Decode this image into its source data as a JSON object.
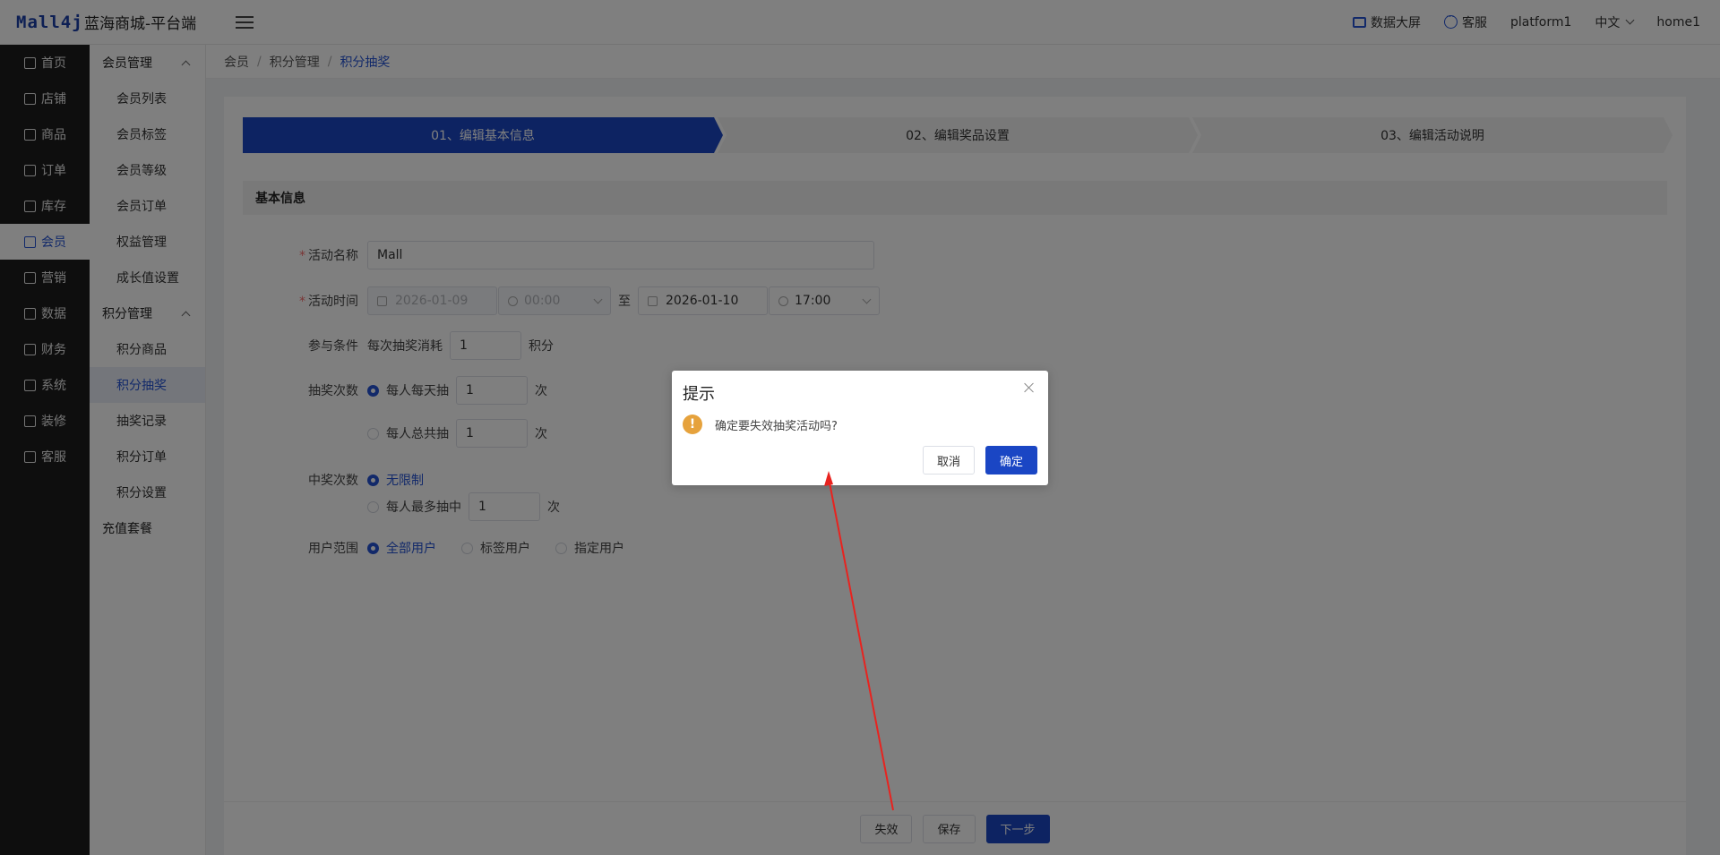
{
  "header": {
    "logo": "Mall4j",
    "app_title": "蓝海商城-平台端",
    "data_screen": "数据大屏",
    "customer_service": "客服",
    "user": "platform1",
    "language": "中文",
    "home": "home1"
  },
  "nav": {
    "items": [
      {
        "label": "首页"
      },
      {
        "label": "店铺"
      },
      {
        "label": "商品"
      },
      {
        "label": "订单"
      },
      {
        "label": "库存"
      },
      {
        "label": "会员"
      },
      {
        "label": "营销"
      },
      {
        "label": "数据"
      },
      {
        "label": "财务"
      },
      {
        "label": "系统"
      },
      {
        "label": "装修"
      },
      {
        "label": "客服"
      }
    ],
    "active_index": 5
  },
  "submenu": {
    "group1": "会员管理",
    "group1_items": [
      "会员列表",
      "会员标签",
      "会员等级",
      "会员订单",
      "权益管理",
      "成长值设置"
    ],
    "group2": "积分管理",
    "group2_items": [
      "积分商品",
      "积分抽奖",
      "抽奖记录",
      "积分订单",
      "积分设置"
    ],
    "extra": "充值套餐",
    "active_item": "积分抽奖"
  },
  "breadcrumb": {
    "items": [
      "会员",
      "积分管理",
      "积分抽奖"
    ]
  },
  "steps": [
    "01、编辑基本信息",
    "02、编辑奖品设置",
    "03、编辑活动说明"
  ],
  "form": {
    "section_title": "基本信息",
    "activity_name_label": "活动名称",
    "activity_name_value": "Mall",
    "activity_time_label": "活动时间",
    "start_date": "2026-01-09",
    "start_time": "00:00",
    "to": "至",
    "end_date": "2026-01-10",
    "end_time": "17:00",
    "condition_label": "参与条件",
    "condition_prefix": "每次抽奖消耗",
    "condition_value": "1",
    "condition_unit": "积分",
    "draw_times_label": "抽奖次数",
    "draw_daily_label": "每人每天抽",
    "draw_daily_value": "1",
    "draw_total_label": "每人总共抽",
    "draw_total_value": "1",
    "times_unit": "次",
    "win_times_label": "中奖次数",
    "win_unlimited": "无限制",
    "win_max_label": "每人最多抽中",
    "win_max_value": "1",
    "user_scope_label": "用户范围",
    "user_all": "全部用户",
    "user_tag": "标签用户",
    "user_specific": "指定用户"
  },
  "bottom": {
    "invalidate": "失效",
    "save": "保存",
    "next": "下一步"
  },
  "dialog": {
    "title": "提示",
    "message": "确定要失效抽奖活动吗?",
    "cancel": "取消",
    "confirm": "确定"
  },
  "colors": {
    "primary": "#1a46c4",
    "warning": "#e6a23c",
    "annotation": "#e8231f"
  }
}
